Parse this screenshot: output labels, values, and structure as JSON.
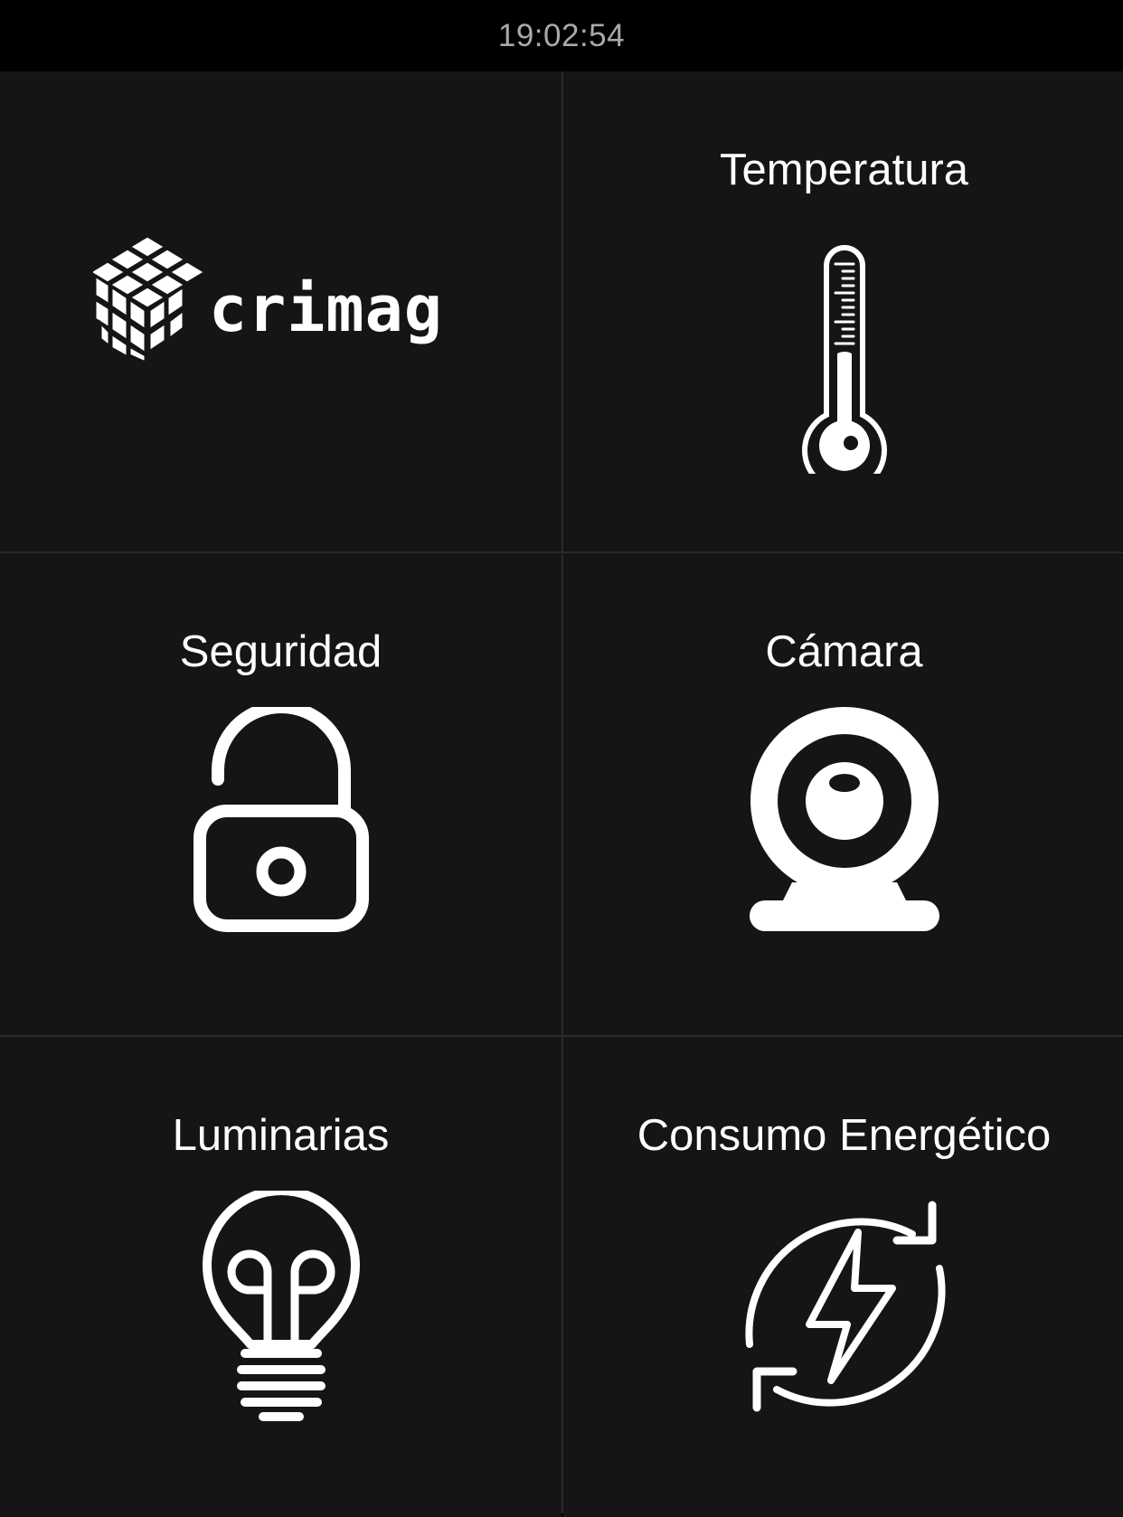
{
  "status_bar": {
    "time": "19:02:54"
  },
  "colors": {
    "background": "#000000",
    "tile_background": "#151515",
    "grid_lines": "#2a2a2a",
    "text": "#ffffff",
    "clock_text": "#a9a9a9"
  },
  "tiles": [
    {
      "id": "logo",
      "label": "",
      "icon": "crimag-logo",
      "logo_text": "crimag"
    },
    {
      "id": "temperature",
      "label": "Temperatura",
      "icon": "thermometer-icon"
    },
    {
      "id": "security",
      "label": "Seguridad",
      "icon": "unlocked-padlock-icon"
    },
    {
      "id": "camera",
      "label": "Cámara",
      "icon": "webcam-icon"
    },
    {
      "id": "lights",
      "label": "Luminarias",
      "icon": "lightbulb-icon"
    },
    {
      "id": "energy",
      "label": "Consumo Energético",
      "icon": "energy-cycle-icon"
    }
  ]
}
